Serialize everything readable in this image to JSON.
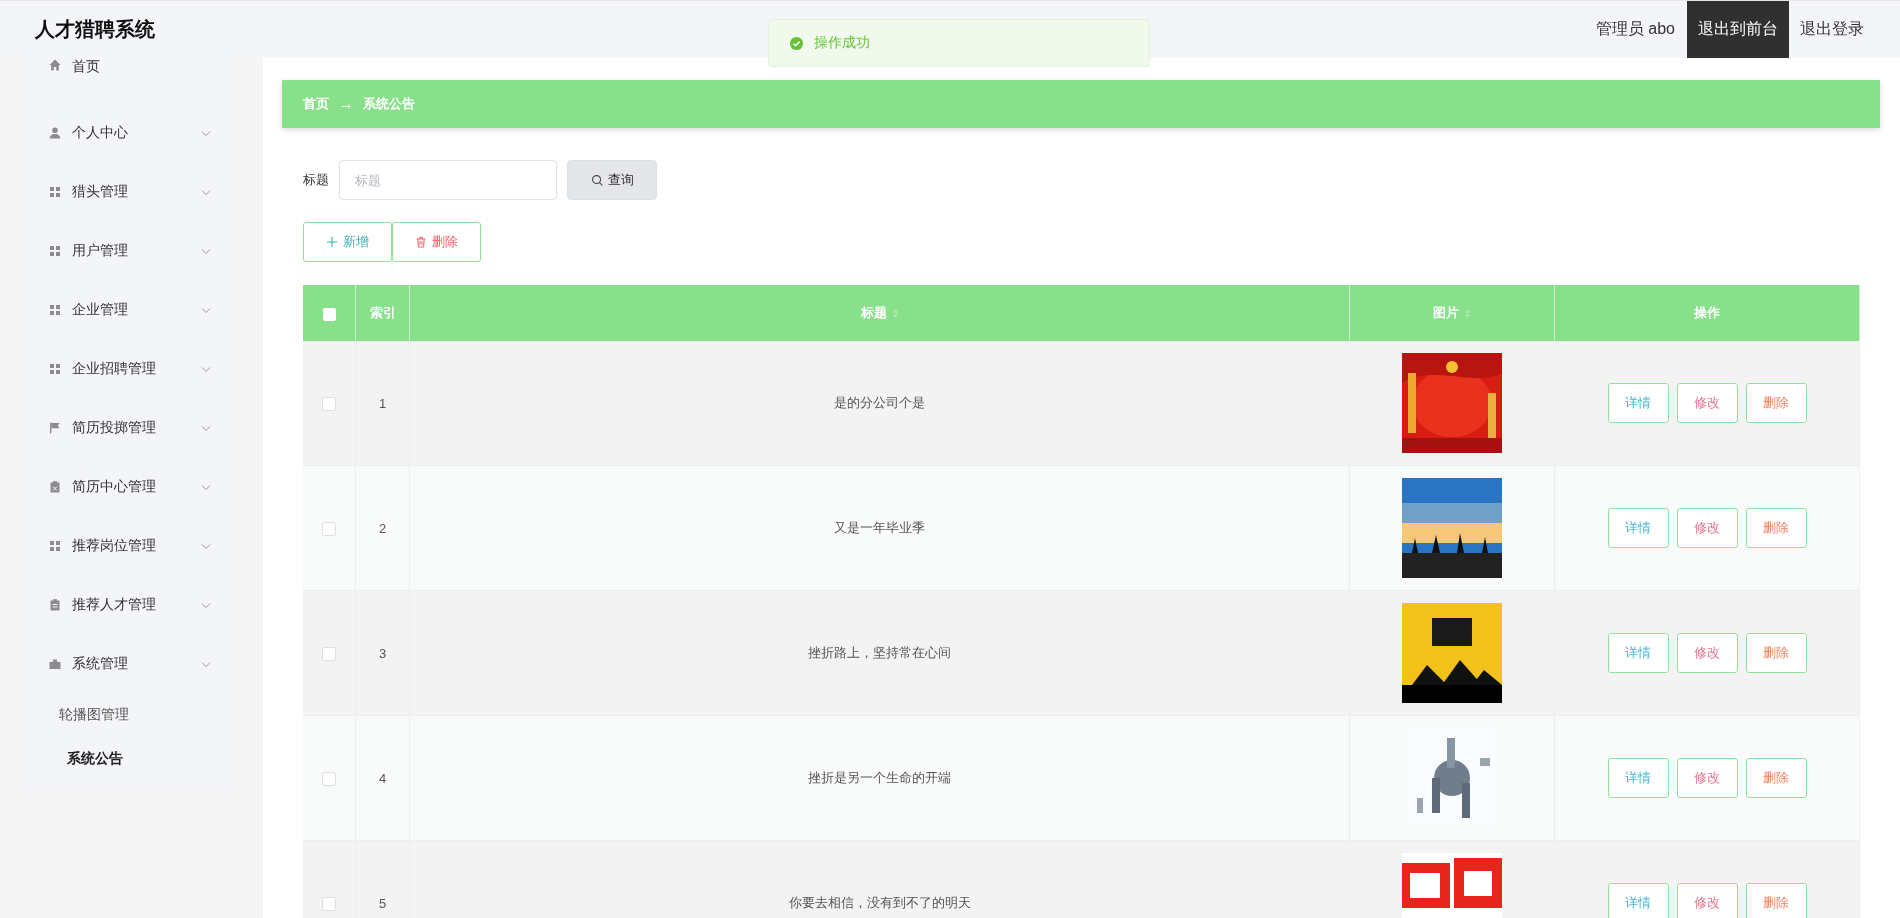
{
  "header": {
    "title": "人才猎聘系统",
    "user": "管理员 abo",
    "links": [
      {
        "label": "退出到前台",
        "selected": true
      },
      {
        "label": "退出登录",
        "selected": false
      }
    ]
  },
  "toast": {
    "kind": "success",
    "message": "操作成功"
  },
  "sidebar": {
    "items": [
      {
        "label": "首页",
        "kind": "link"
      },
      {
        "label": "个人中心",
        "kind": "submenu"
      },
      {
        "label": "猎头管理",
        "kind": "submenu"
      },
      {
        "label": "用户管理",
        "kind": "submenu"
      },
      {
        "label": "企业管理",
        "kind": "submenu"
      },
      {
        "label": "企业招聘管理",
        "kind": "submenu"
      },
      {
        "label": "简历投掷管理",
        "kind": "submenu"
      },
      {
        "label": "简历中心管理",
        "kind": "submenu"
      },
      {
        "label": "推荐岗位管理",
        "kind": "submenu"
      },
      {
        "label": "推荐人才管理",
        "kind": "submenu"
      },
      {
        "label": "系统管理",
        "kind": "submenu",
        "children": [
          {
            "label": "轮播图管理",
            "selected": false
          },
          {
            "label": "系统公告",
            "selected": true
          }
        ]
      }
    ]
  },
  "breadcrumb": [
    "首页",
    "系统公告"
  ],
  "breadcrumb_separator": "→",
  "search": {
    "label": "标题",
    "placeholder": "标题",
    "button": "查询"
  },
  "actions": [
    {
      "label": "新增",
      "kind": "add"
    },
    {
      "label": "删除",
      "kind": "delete"
    }
  ],
  "table": {
    "columns": [
      {
        "kind": "check"
      },
      {
        "label": "索引",
        "kind": "index",
        "sortable": false
      },
      {
        "label": "标题",
        "kind": "text",
        "sortable": true
      },
      {
        "label": "图片",
        "sortable": true
      },
      {
        "label": "操作",
        "kind": "ops",
        "sortable": false
      }
    ],
    "header_checked": false,
    "rows": [
      {
        "checked": false,
        "index": "1",
        "title": "是的分公司个是",
        "buttons": [
          "详情",
          "修改",
          "删除"
        ]
      },
      {
        "checked": false,
        "index": "2",
        "title": "又是一年毕业季",
        "buttons": [
          "详情",
          "修改",
          "删除"
        ]
      },
      {
        "checked": false,
        "index": "3",
        "title": "挫折路上，坚持常在心间",
        "buttons": [
          "详情",
          "修改",
          "删除"
        ]
      },
      {
        "checked": false,
        "index": "4",
        "title": "挫折是另一个生命的开端",
        "buttons": [
          "详情",
          "修改",
          "删除"
        ]
      },
      {
        "checked": false,
        "index": "5",
        "title": "你要去相信，没有到不了的明天",
        "buttons": [
          "详情",
          "修改",
          "删除"
        ]
      }
    ]
  }
}
